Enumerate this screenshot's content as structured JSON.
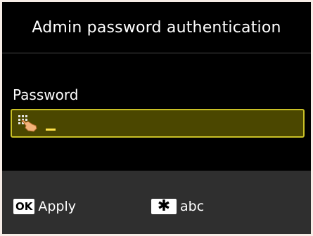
{
  "header": {
    "title": "Admin password authentication"
  },
  "form": {
    "password_label": "Password",
    "password_value": "",
    "input_mode_icon": "hand-pointer-keypad-icon"
  },
  "footer": {
    "apply_key": "OK",
    "apply_label": "Apply",
    "mode_key": "✱",
    "mode_label": "abc"
  },
  "colors": {
    "screen_bg": "#000000",
    "field_bg": "#4b4700",
    "field_border": "#c9c026",
    "footer_bg": "#2f2f2f",
    "cursor": "#ffe24a"
  }
}
